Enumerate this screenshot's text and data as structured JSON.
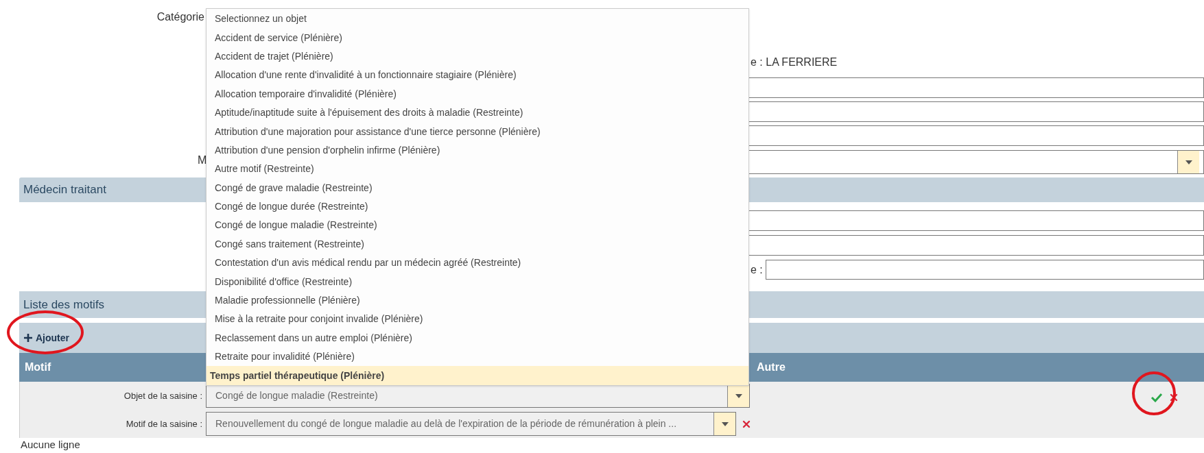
{
  "form": {
    "category_label": "Catégorie",
    "partial_label": "M",
    "site_label": "e : LA FERRIERE",
    "fields": [
      {
        "kind": "input"
      },
      {
        "kind": "input"
      },
      {
        "kind": "input"
      },
      {
        "kind": "select"
      }
    ]
  },
  "doctor_section": {
    "title": "Médecin traitant",
    "fields": [
      {
        "kind": "input"
      },
      {
        "kind": "input"
      }
    ],
    "partial_label": "e :"
  },
  "reasons_section": {
    "title": "Liste des motifs",
    "add_button": "Ajouter",
    "columns": [
      "Motif",
      "Autre"
    ],
    "edit_row": {
      "object_label": "Objet de la saisine :",
      "object_value": "Congé de longue maladie (Restreinte)",
      "reason_label": "Motif de la saisine :",
      "reason_value": "Renouvellement du congé de longue maladie au delà de l'expiration de la période de rémunération à plein ..."
    },
    "empty_text": "Aucune ligne"
  },
  "dropdown": {
    "options": [
      {
        "label": "Selectionnez un objet",
        "selected": false
      },
      {
        "label": "Accident de service (Plénière)",
        "selected": false
      },
      {
        "label": "Accident de trajet (Plénière)",
        "selected": false
      },
      {
        "label": "Allocation d'une rente d'invalidité à un fonctionnaire stagiaire (Plénière)",
        "selected": false
      },
      {
        "label": "Allocation temporaire d'invalidité (Plénière)",
        "selected": false
      },
      {
        "label": "Aptitude/inaptitude suite à l'épuisement des droits à maladie (Restreinte)",
        "selected": false
      },
      {
        "label": "Attribution d'une majoration pour assistance d'une tierce personne (Plénière)",
        "selected": false
      },
      {
        "label": "Attribution d'une pension d'orphelin infirme (Plénière)",
        "selected": false
      },
      {
        "label": "Autre motif (Restreinte)",
        "selected": false
      },
      {
        "label": "Congé de grave maladie (Restreinte)",
        "selected": false
      },
      {
        "label": "Congé de longue durée (Restreinte)",
        "selected": false
      },
      {
        "label": "Congé de longue maladie (Restreinte)",
        "selected": false
      },
      {
        "label": "Congé sans traitement (Restreinte)",
        "selected": false
      },
      {
        "label": "Contestation d'un avis médical rendu par un médecin agréé (Restreinte)",
        "selected": false
      },
      {
        "label": "Disponibilité d'office (Restreinte)",
        "selected": false
      },
      {
        "label": "Maladie professionnelle (Plénière)",
        "selected": false
      },
      {
        "label": "Mise à la retraite pour conjoint invalide (Plénière)",
        "selected": false
      },
      {
        "label": "Reclassement dans un autre emploi (Plénière)",
        "selected": false
      },
      {
        "label": "Retraite pour invalidité (Plénière)",
        "selected": false
      },
      {
        "label": "Temps partiel thérapeutique (Plénière)",
        "selected": true
      }
    ]
  }
}
